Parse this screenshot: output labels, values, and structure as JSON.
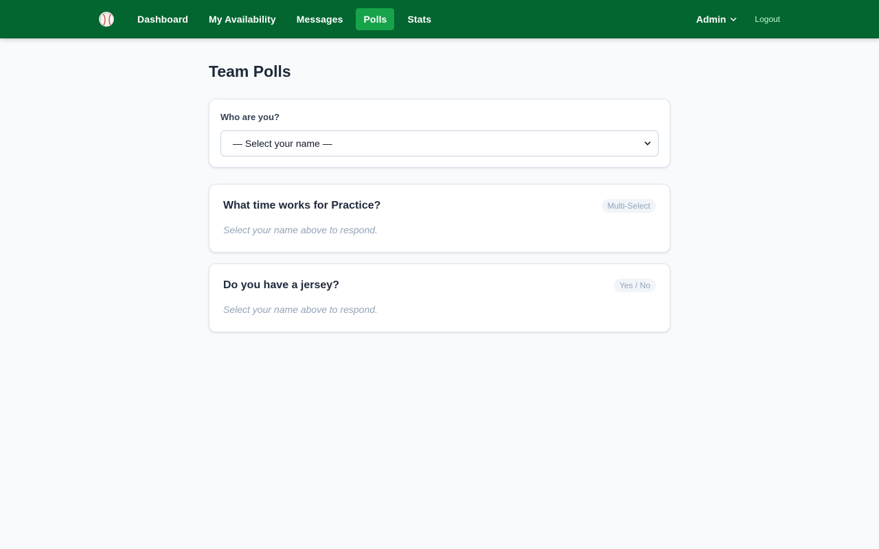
{
  "nav": {
    "logo_icon": "baseball-icon",
    "links": [
      {
        "label": "Dashboard",
        "active": false
      },
      {
        "label": "My Availability",
        "active": false
      },
      {
        "label": "Messages",
        "active": false
      },
      {
        "label": "Polls",
        "active": true
      },
      {
        "label": "Stats",
        "active": false
      }
    ],
    "user_menu": "Admin",
    "logout": "Logout"
  },
  "page": {
    "title": "Team Polls"
  },
  "identity": {
    "label": "Who are you?",
    "select_value": "— Select your name —"
  },
  "polls": [
    {
      "question": "What time works for Practice?",
      "type_badge": "Multi-Select",
      "hint": "Select your name above to respond."
    },
    {
      "question": "Do you have a jersey?",
      "type_badge": "Yes / No",
      "hint": "Select your name above to respond."
    }
  ],
  "colors": {
    "nav_bg": "#03652f",
    "nav_active": "#16a34a",
    "page_bg": "#f8fafc"
  }
}
